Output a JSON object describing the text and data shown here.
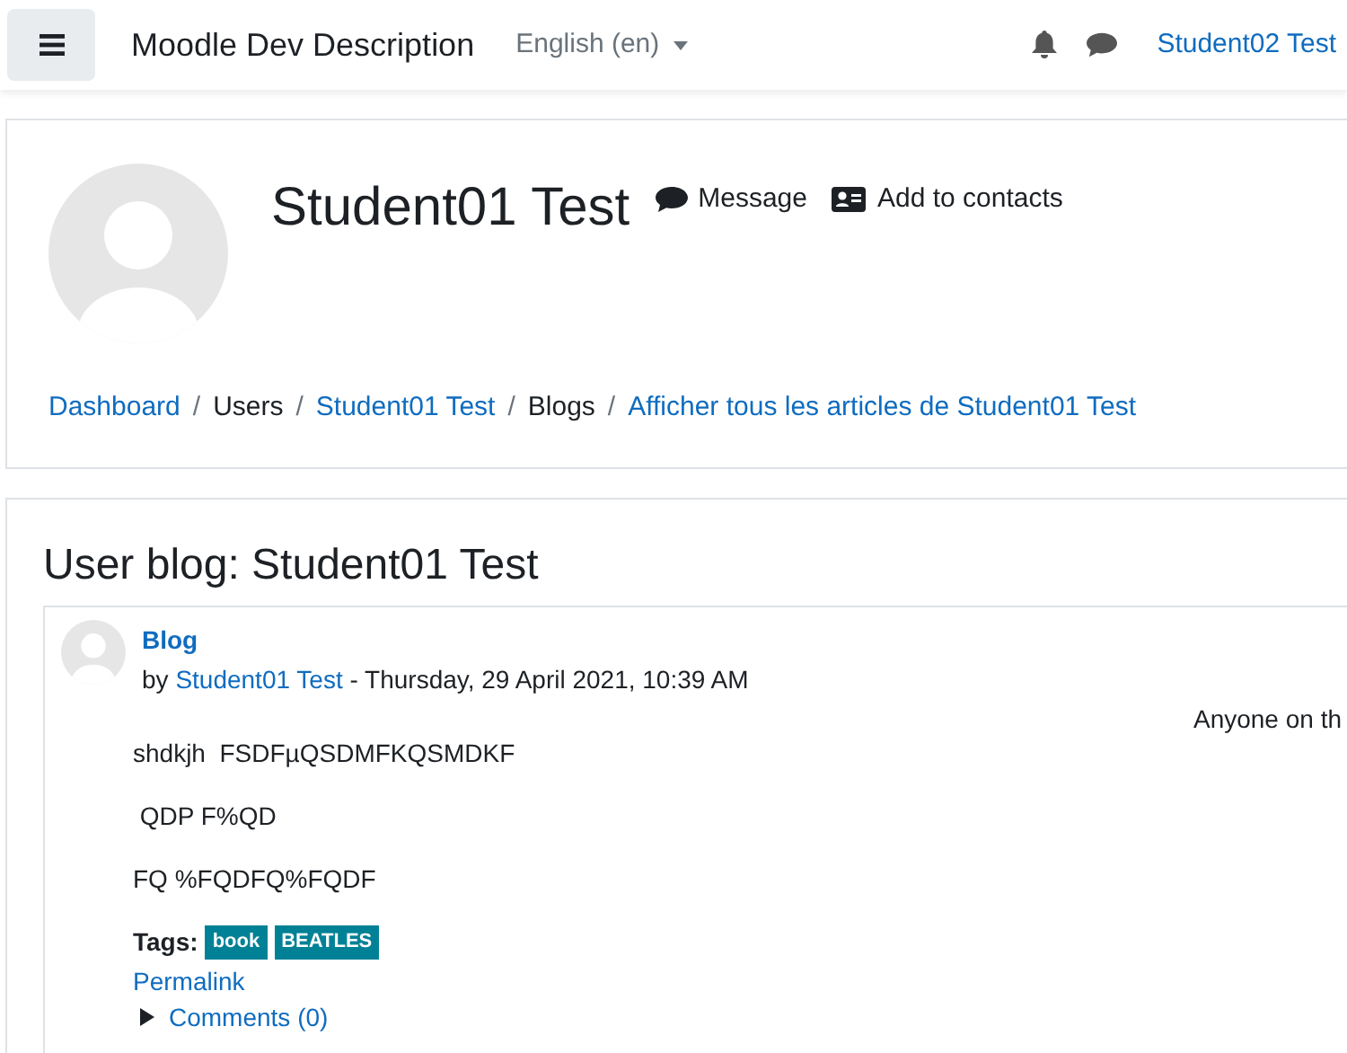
{
  "navbar": {
    "site_name": "Moodle Dev Description",
    "language": "English (en)",
    "user": "Student02 Test"
  },
  "profile": {
    "name": "Student01 Test",
    "actions": [
      {
        "kind": "message",
        "label": "Message"
      },
      {
        "kind": "contact",
        "label": "Add to contacts"
      }
    ]
  },
  "breadcrumb_separator": "/",
  "breadcrumb": [
    {
      "label": "Dashboard",
      "link": true
    },
    {
      "label": "Users",
      "link": false
    },
    {
      "label": "Student01 Test",
      "link": true
    },
    {
      "label": "Blogs",
      "link": false
    },
    {
      "label": "Afficher tous les articles de Student01 Test",
      "link": true
    }
  ],
  "blog": {
    "title": "User blog: Student01 Test",
    "post": {
      "subject": "Blog",
      "by": "by",
      "author": "Student01 Test",
      "date": "- Thursday, 29 April 2021, 10:39 AM",
      "visibility": "Anyone on th",
      "paragraphs": [
        "shdkjh  FSDFµQSDMFKQSMDKF",
        " QDP F%QD",
        "FQ %FQDFQ%FQDF"
      ],
      "tags_label": "Tags:",
      "tags": [
        "book",
        "BEATLES"
      ],
      "permalink": "Permalink",
      "comments": "Comments (0)",
      "comments_expanded": false
    }
  }
}
